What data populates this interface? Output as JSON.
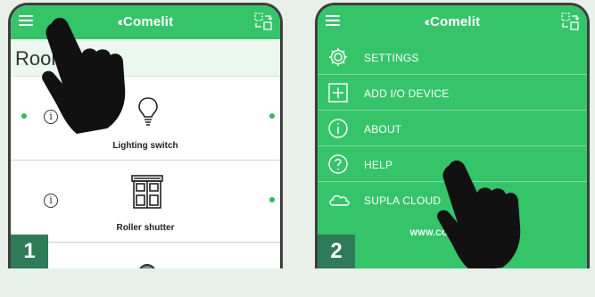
{
  "panel1": {
    "badge": "1",
    "brand": "Comelit",
    "section_title": "Rooms",
    "devices": [
      {
        "name": "Lighting switch",
        "icon": "bulb-icon",
        "status_dot_left": true
      },
      {
        "name": "Roller shutter",
        "icon": "shutter-icon",
        "status_dot_left": false
      }
    ]
  },
  "panel2": {
    "badge": "2",
    "brand": "Comelit",
    "menu": [
      {
        "label": "SETTINGS",
        "icon": "gear-icon"
      },
      {
        "label": "ADD I/O DEVICE",
        "icon": "plus-square-icon"
      },
      {
        "label": "ABOUT",
        "icon": "info-icon"
      },
      {
        "label": "HELP",
        "icon": "question-icon"
      },
      {
        "label": "SUPLA CLOUD",
        "icon": "cloud-icon"
      }
    ],
    "website": "WWW.COMELIT.COM"
  },
  "colors": {
    "brand_green": "#36c46a",
    "badge_green": "#2f7a57",
    "status_dot": "#2fb862"
  }
}
